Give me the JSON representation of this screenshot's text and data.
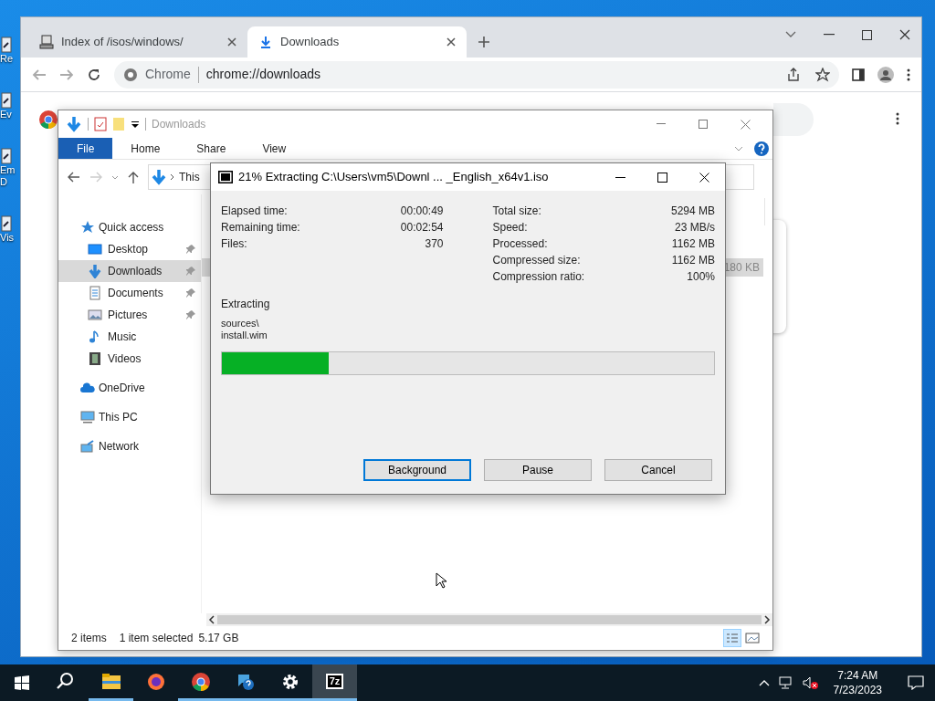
{
  "desktop_icons": [
    {
      "label": "Re"
    },
    {
      "label": "Ev"
    },
    {
      "label": "Em\nD"
    },
    {
      "label": "Vis"
    }
  ],
  "chrome": {
    "tabs": [
      {
        "title": "Index of /isos/windows/",
        "selected": false,
        "kind": "server"
      },
      {
        "title": "Downloads",
        "selected": true,
        "kind": "download"
      }
    ],
    "address": {
      "site": "Chrome",
      "url": "chrome://downloads"
    }
  },
  "explorer": {
    "title": "Downloads",
    "ribbon_tabs": [
      {
        "label": "File",
        "selected": true
      },
      {
        "label": "Home",
        "selected": false
      },
      {
        "label": "Share",
        "selected": false
      },
      {
        "label": "View",
        "selected": false
      }
    ],
    "breadcrumb": "This",
    "nav": [
      {
        "label": "Quick access",
        "kind": "star",
        "selected": false,
        "children": [
          {
            "label": "Desktop",
            "kind": "desktop",
            "selected": false,
            "pinned": true
          },
          {
            "label": "Downloads",
            "kind": "download",
            "selected": true,
            "pinned": true
          },
          {
            "label": "Documents",
            "kind": "document",
            "selected": false,
            "pinned": true
          },
          {
            "label": "Pictures",
            "kind": "picture",
            "selected": false,
            "pinned": true
          },
          {
            "label": "Music",
            "kind": "music",
            "selected": false,
            "pinned": false
          },
          {
            "label": "Videos",
            "kind": "video",
            "selected": false,
            "pinned": false
          }
        ]
      },
      {
        "label": "OneDrive",
        "kind": "cloud",
        "selected": false
      },
      {
        "label": "This PC",
        "kind": "pc",
        "selected": false
      },
      {
        "label": "Network",
        "kind": "network",
        "selected": false
      }
    ],
    "file_size": "180 KB",
    "status": [
      "2 items",
      "1 item selected",
      "5.17 GB"
    ]
  },
  "dialog": {
    "title": "21% Extracting C:\\Users\\vm5\\Downl ... _English_x64v1.iso",
    "left_stats": [
      {
        "label": "Elapsed time:",
        "value": "00:00:49"
      },
      {
        "label": "Remaining time:",
        "value": "00:02:54"
      },
      {
        "label": "Files:",
        "value": "370"
      }
    ],
    "right_stats": [
      {
        "label": "Total size:",
        "value": "5294 MB"
      },
      {
        "label": "Speed:",
        "value": "23 MB/s"
      },
      {
        "label": "Processed:",
        "value": "1162 MB"
      },
      {
        "label": "Compressed size:",
        "value": "1162 MB"
      },
      {
        "label": "Compression ratio:",
        "value": "100%"
      }
    ],
    "operation": "Extracting",
    "path": [
      "sources\\",
      "install.wim"
    ],
    "level": 0.217,
    "buttons": [
      {
        "label": "Background",
        "focused": true
      },
      {
        "label": "Pause",
        "focused": false
      },
      {
        "label": "Cancel",
        "focused": false
      }
    ]
  },
  "taskbar": {
    "apps": [
      {
        "kind": "search",
        "running": false
      },
      {
        "kind": "folder",
        "running": true
      },
      {
        "kind": "firefox",
        "running": false
      },
      {
        "kind": "chrome",
        "running": true
      },
      {
        "kind": "help",
        "running": true
      },
      {
        "kind": "settings",
        "running": true
      },
      {
        "kind": "sevenzip",
        "label": "7z",
        "running": true,
        "active": true
      }
    ],
    "time": "7:24 AM",
    "date": "7/23/2023"
  }
}
